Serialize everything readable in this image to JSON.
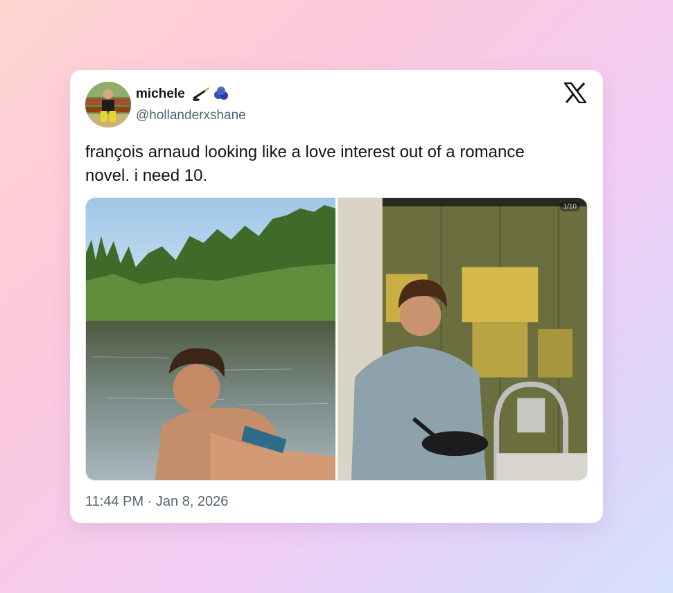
{
  "tweet": {
    "display_name": "michele",
    "name_emojis": [
      "hockey-stick-puck-emoji",
      "blueberries-emoji"
    ],
    "handle": "@hollanderxshane",
    "text": "françois arnaud looking like a love interest out of a romance novel. i need 10.",
    "timestamp": "11:44 PM · Jan 8, 2026",
    "avatar": "avatar-photo",
    "logo": "x-logo-icon"
  },
  "media": {
    "photos": [
      {
        "description": "man leaning on dock by lake with forest"
      },
      {
        "description": "man holding frying pan in kitchen"
      }
    ],
    "counter": "1/10"
  },
  "colors": {
    "text_primary": "#0f1419",
    "text_secondary": "#536471",
    "card_bg": "#ffffff"
  }
}
